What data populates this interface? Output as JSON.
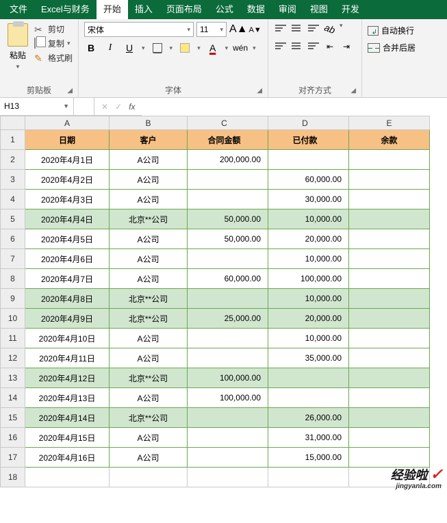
{
  "menubar": {
    "items": [
      "文件",
      "Excel与财务",
      "开始",
      "插入",
      "页面布局",
      "公式",
      "数据",
      "审阅",
      "视图",
      "开发"
    ],
    "active_index": 2
  },
  "ribbon": {
    "clipboard": {
      "paste": "粘贴",
      "cut": "剪切",
      "copy": "复制",
      "format_painter": "格式刷",
      "group_label": "剪贴板"
    },
    "font": {
      "font_name": "宋体",
      "font_size": "11",
      "bold": "B",
      "italic": "I",
      "underline": "U",
      "fontcolor_letter": "A",
      "wen": "wén",
      "group_label": "字体"
    },
    "align": {
      "group_label": "对齐方式"
    },
    "right": {
      "wrap": "自动换行",
      "merge": "合并后居"
    }
  },
  "formula_bar": {
    "name_box": "H13",
    "cancel": "✕",
    "confirm": "✓",
    "fx": "fx",
    "value": ""
  },
  "columns": [
    "A",
    "B",
    "C",
    "D",
    "E"
  ],
  "headers": [
    "日期",
    "客户",
    "合同金额",
    "已付款",
    "余款"
  ],
  "rows": [
    {
      "n": 1,
      "hdr": true
    },
    {
      "n": 2,
      "a": "2020年4月1日",
      "b": "A公司",
      "c": "200,000.00",
      "d": "",
      "e": ""
    },
    {
      "n": 3,
      "a": "2020年4月2日",
      "b": "A公司",
      "c": "",
      "d": "60,000.00",
      "e": ""
    },
    {
      "n": 4,
      "a": "2020年4月3日",
      "b": "A公司",
      "c": "",
      "d": "30,000.00",
      "e": ""
    },
    {
      "n": 5,
      "a": "2020年4月4日",
      "b": "北京**公司",
      "c": "50,000.00",
      "d": "10,000.00",
      "e": "",
      "g": true
    },
    {
      "n": 6,
      "a": "2020年4月5日",
      "b": "A公司",
      "c": "50,000.00",
      "d": "20,000.00",
      "e": ""
    },
    {
      "n": 7,
      "a": "2020年4月6日",
      "b": "A公司",
      "c": "",
      "d": "10,000.00",
      "e": ""
    },
    {
      "n": 8,
      "a": "2020年4月7日",
      "b": "A公司",
      "c": "60,000.00",
      "d": "100,000.00",
      "e": ""
    },
    {
      "n": 9,
      "a": "2020年4月8日",
      "b": "北京**公司",
      "c": "",
      "d": "10,000.00",
      "e": "",
      "g": true
    },
    {
      "n": 10,
      "a": "2020年4月9日",
      "b": "北京**公司",
      "c": "25,000.00",
      "d": "20,000.00",
      "e": "",
      "g": true
    },
    {
      "n": 11,
      "a": "2020年4月10日",
      "b": "A公司",
      "c": "",
      "d": "10,000.00",
      "e": ""
    },
    {
      "n": 12,
      "a": "2020年4月11日",
      "b": "A公司",
      "c": "",
      "d": "35,000.00",
      "e": ""
    },
    {
      "n": 13,
      "a": "2020年4月12日",
      "b": "北京**公司",
      "c": "100,000.00",
      "d": "",
      "e": "",
      "g": true
    },
    {
      "n": 14,
      "a": "2020年4月13日",
      "b": "A公司",
      "c": "100,000.00",
      "d": "",
      "e": ""
    },
    {
      "n": 15,
      "a": "2020年4月14日",
      "b": "北京**公司",
      "c": "",
      "d": "26,000.00",
      "e": "",
      "g": true
    },
    {
      "n": 16,
      "a": "2020年4月15日",
      "b": "A公司",
      "c": "",
      "d": "31,000.00",
      "e": ""
    },
    {
      "n": 17,
      "a": "2020年4月16日",
      "b": "A公司",
      "c": "",
      "d": "15,000.00",
      "e": ""
    }
  ],
  "extra_row": 18,
  "watermark": {
    "text": "经验啦",
    "check": "✓",
    "sub": "jingyanla.com"
  }
}
